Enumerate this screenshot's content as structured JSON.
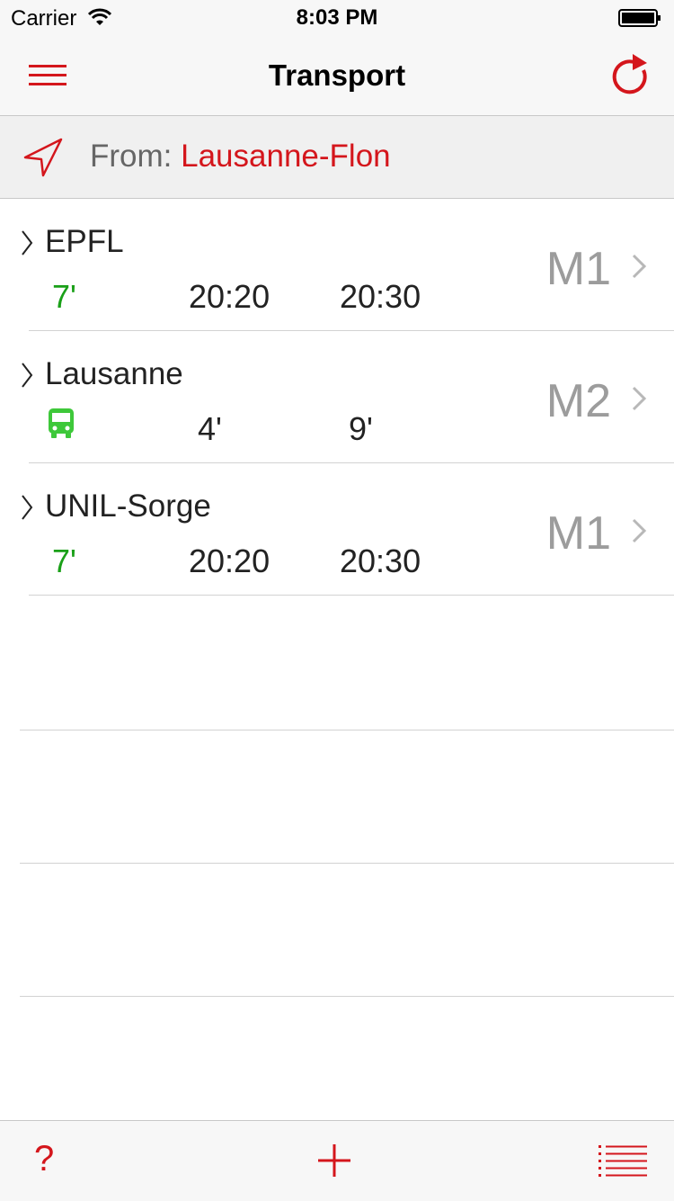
{
  "status_bar": {
    "carrier": "Carrier",
    "time": "8:03 PM"
  },
  "nav": {
    "title": "Transport"
  },
  "from": {
    "label": "From:",
    "station": "Lausanne-Flon"
  },
  "departures": [
    {
      "destination": "EPFL",
      "line": "M1",
      "times": [
        "7'",
        "20:20",
        "20:30"
      ]
    },
    {
      "destination": "Lausanne",
      "line": "M2",
      "times": [
        "4'",
        "9'"
      ]
    },
    {
      "destination": "UNIL-Sorge",
      "line": "M1",
      "times": [
        "7'",
        "20:20",
        "20:30"
      ]
    }
  ],
  "toolbar": {
    "help_label": "?"
  },
  "colors": {
    "accent": "#d4161c",
    "soon": "#1aa018",
    "bus": "#3ec83a"
  },
  "icons": {
    "nav_left": "hamburger-menu-icon",
    "nav_right": "refresh-icon",
    "from": "location-arrow-icon",
    "row_expand": "chevron-right-icon",
    "bus": "bus-icon",
    "toolbar_add": "plus-icon",
    "toolbar_list": "list-icon"
  }
}
